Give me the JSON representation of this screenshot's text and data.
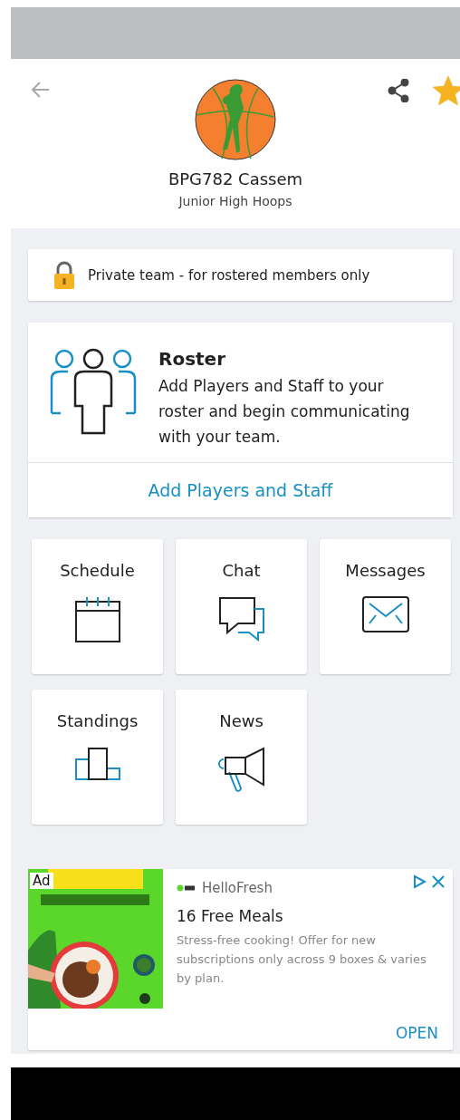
{
  "header": {
    "team_name": "BPG782 Cassem",
    "subtitle": "Junior High Hoops",
    "favorite": true
  },
  "privacy": {
    "text": "Private team - for rostered members only",
    "locked": true
  },
  "roster": {
    "title": "Roster",
    "description": "Add Players and Staff to your roster and begin communicating with your team.",
    "action": "Add Players and Staff"
  },
  "tiles": [
    {
      "label": "Schedule",
      "kind": "calendar"
    },
    {
      "label": "Chat",
      "kind": "chat"
    },
    {
      "label": "Messages",
      "kind": "mail"
    },
    {
      "label": "Standings",
      "kind": "podium"
    },
    {
      "label": "News",
      "kind": "megaphone"
    }
  ],
  "ad": {
    "badge": "Ad",
    "advertiser": "HelloFresh",
    "headline": "16 Free Meals",
    "body": "Stress-free cooking! Offer for new subscriptions only across 9 boxes & varies by plan.",
    "cta": "OPEN"
  }
}
